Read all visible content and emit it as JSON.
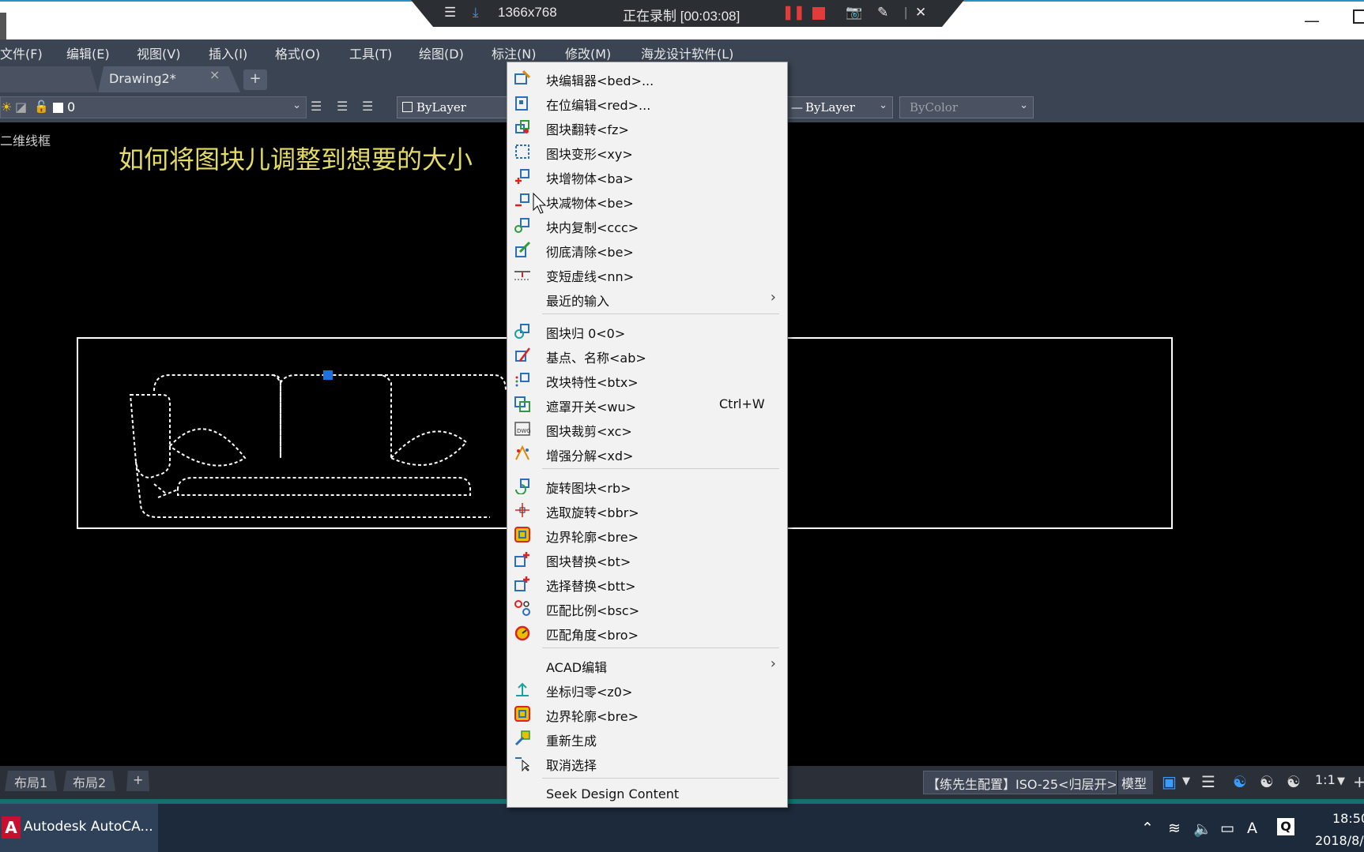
{
  "recorder": {
    "resolution": "1366x768",
    "status": "正在录制 [00:03:08]"
  },
  "menubar": {
    "items": [
      "文件(F)",
      "编辑(E)",
      "视图(V)",
      "插入(I)",
      "格式(O)",
      "工具(T)",
      "绘图(D)",
      "标注(N)",
      "修改(M)",
      "海龙设计软件(L)"
    ]
  },
  "tabs": {
    "drawing": "Drawing2*",
    "close": "×",
    "add": "+"
  },
  "toolbar": {
    "layer_name": "0",
    "color_combo": "ByLayer",
    "linetype_combo": "ByLayer",
    "plotstyle_combo": "ByColor"
  },
  "canvas": {
    "view_label": "二维线框",
    "overlay_text": "如何将图块儿调整到想要的大小"
  },
  "layout_tabs": [
    "布局1",
    "布局2"
  ],
  "layout_add": "+",
  "status": {
    "config": "【练先生配置】ISO-25<归层开>",
    "model": "模型",
    "scale": "1:1"
  },
  "taskbar": {
    "app_label": "Autodesk AutoCA...",
    "time": "18:50",
    "date": "2018/8/"
  },
  "context_menu": {
    "items": [
      {
        "label": "块编辑器<bed>...",
        "icon": "block-editor-icon"
      },
      {
        "label": "在位编辑<red>...",
        "icon": "refedit-icon"
      },
      {
        "label": "图块翻转<fz>",
        "icon": "block-flip-icon"
      },
      {
        "label": "图块变形<xy>",
        "icon": "block-deform-icon"
      },
      {
        "label": "块增物体<ba>",
        "icon": "block-add-object-icon"
      },
      {
        "label": "块减物体<be>",
        "icon": "block-remove-object-icon"
      },
      {
        "label": "块内复制<ccc>",
        "icon": "block-copy-icon"
      },
      {
        "label": "彻底清除<be>",
        "icon": "purge-icon"
      },
      {
        "label": "变短虚线<nn>",
        "icon": "short-dash-icon"
      },
      {
        "label": "最近的输入",
        "icon": "",
        "submenu": "›"
      },
      {
        "label": "图块归 0<0>",
        "icon": "block-zero-icon"
      },
      {
        "label": "基点、名称<ab>",
        "icon": "basepoint-name-icon"
      },
      {
        "label": "改块特性<btx>",
        "icon": "block-property-icon"
      },
      {
        "label": "遮罩开关<wu>",
        "icon": "wipeout-toggle-icon",
        "shortcut": "Ctrl+W"
      },
      {
        "label": "图块裁剪<xc>",
        "icon": "block-clip-icon"
      },
      {
        "label": "增强分解<xd>",
        "icon": "explode-icon"
      },
      {
        "label": "旋转图块<rb>",
        "icon": "rotate-block-icon"
      },
      {
        "label": "选取旋转<bbr>",
        "icon": "pick-rotate-icon"
      },
      {
        "label": "边界轮廓<bre>",
        "icon": "boundary-outline-icon"
      },
      {
        "label": "图块替换<bt>",
        "icon": "block-replace-icon"
      },
      {
        "label": "选择替换<btt>",
        "icon": "select-replace-icon"
      },
      {
        "label": "匹配比例<bsc>",
        "icon": "match-scale-icon"
      },
      {
        "label": "匹配角度<bro>",
        "icon": "match-angle-icon"
      },
      {
        "label": "ACAD编辑",
        "icon": "",
        "submenu": "›"
      },
      {
        "label": "坐标归零<z0>",
        "icon": "coords-zero-icon"
      },
      {
        "label": "边界轮廓<bre>",
        "icon": "boundary-outline-icon"
      },
      {
        "label": "重新生成",
        "icon": "regen-icon"
      },
      {
        "label": "取消选择",
        "icon": "deselect-icon"
      },
      {
        "label": "Seek Design Content",
        "icon": ""
      }
    ]
  }
}
